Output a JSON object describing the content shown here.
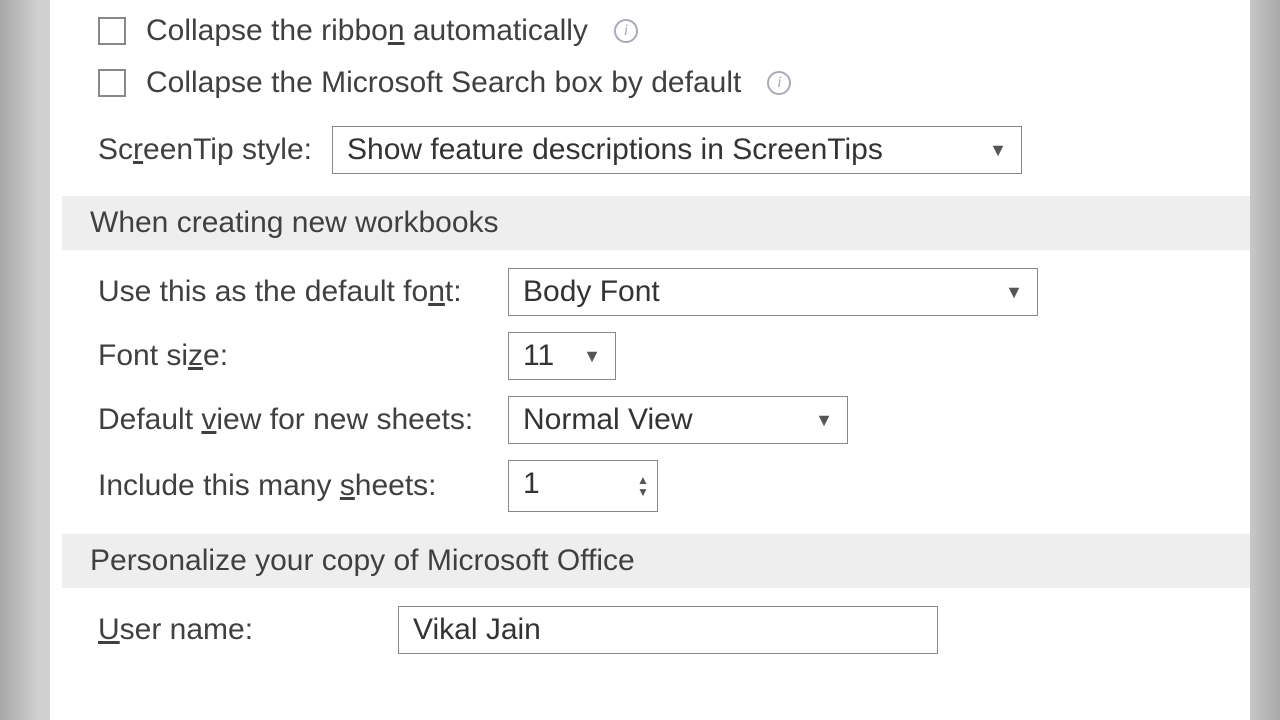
{
  "ribbon": {
    "collapse_ribbon_label": "Collapse the ribbon automatically",
    "collapse_search_label": "Collapse the Microsoft Search box by default",
    "screentip_label": "ScreenTip style:",
    "screentip_value": "Show feature descriptions in ScreenTips"
  },
  "workbooks_section": {
    "header": "When creating new workbooks",
    "default_font_label": "Use this as the default font:",
    "default_font_value": "Body Font",
    "font_size_label": "Font size:",
    "font_size_value": "11",
    "default_view_label": "Default view for new sheets:",
    "default_view_value": "Normal View",
    "sheets_count_label": "Include this many sheets:",
    "sheets_count_value": "1"
  },
  "personalize_section": {
    "header": "Personalize your copy of Microsoft Office",
    "user_name_label": "User name:",
    "user_name_value": "Vikal Jain"
  }
}
